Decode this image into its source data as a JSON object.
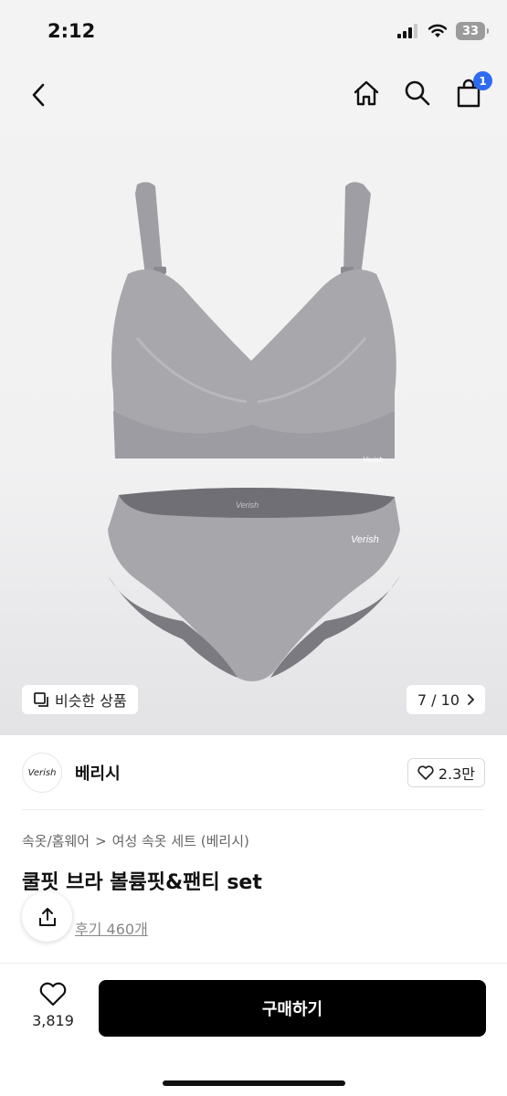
{
  "status": {
    "time": "2:12",
    "battery": "33"
  },
  "nav": {
    "cart_count": "1"
  },
  "gallery": {
    "similar_label": "비슷한 상품",
    "page_indicator": "7 / 10",
    "product_logo": "Verish"
  },
  "brand": {
    "logo_text": "Verish",
    "name": "베리시",
    "likes": "2.3만"
  },
  "breadcrumb": {
    "category": "속옷/홈웨어",
    "separator": ">",
    "subcategory": "여성 속옷 세트 (베리시)"
  },
  "product": {
    "title": "쿨핏 브라 볼륨핏&팬티 set",
    "reviews": "후기 460개"
  },
  "bottom": {
    "wish_count": "3,819",
    "buy_label": "구매하기"
  },
  "colors": {
    "accent": "#2f6bf2",
    "buy_button": "#000000",
    "garment": "#a5a5aa"
  }
}
